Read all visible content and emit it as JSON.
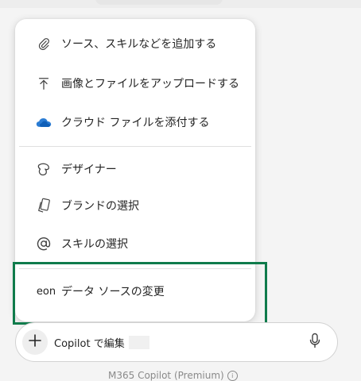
{
  "menu": {
    "items": [
      {
        "label": "ソース、スキルなどを追加する",
        "icon": "paperclip-icon"
      },
      {
        "label": "画像とファイルをアップロードする",
        "icon": "upload-icon"
      },
      {
        "label": "クラウド ファイルを添付する",
        "icon": "onedrive-cloud-icon"
      },
      {
        "label": "デザイナー",
        "icon": "designer-icon"
      },
      {
        "label": "ブランドの選択",
        "icon": "brand-kit-icon"
      },
      {
        "label": "スキルの選択",
        "icon": "at-sign-icon"
      },
      {
        "label": "データ ソースの変更",
        "icon": "eon-icon",
        "icon_text": "eon"
      }
    ]
  },
  "composer": {
    "text": "Copilot で編集",
    "add_icon": "plus-icon",
    "mic_icon": "microphone-icon"
  },
  "footer": {
    "label": "M365 Copilot (Premium)",
    "info_icon": "info-icon",
    "info_glyph": "i"
  },
  "colors": {
    "highlight": "#0f7b4b",
    "cloud": "#2b7cd3"
  }
}
